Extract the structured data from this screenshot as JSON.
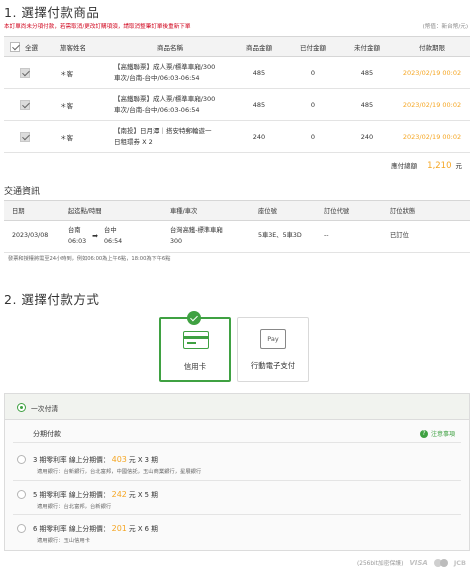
{
  "section1": {
    "title": "1. 選擇付款商品",
    "warning": "本訂單尚未分項付款，若需取消/更改訂購項須，請取消整筆訂單後重新下單",
    "unit_note": "(幣值：新台幣/元)",
    "headers": {
      "select_all": "全選",
      "traveler": "旅客姓名",
      "product": "商品名稱",
      "amount": "商品金額",
      "paid": "已付金額",
      "unpaid": "未付金額",
      "deadline": "付款期限"
    },
    "rows": [
      {
        "traveler": "＊客",
        "product_line1": "【高鐵聯票】成人票/標準車廂/300",
        "product_line2": "車次/台南-台中/06:03-06:54",
        "amount": "485",
        "paid": "0",
        "unpaid": "485",
        "deadline": "2023/02/19 00:02"
      },
      {
        "traveler": "＊客",
        "product_line1": "【高鐵聯票】成人票/標準車廂/300",
        "product_line2": "車次/台南-台中/06:03-06:54",
        "amount": "485",
        "paid": "0",
        "unpaid": "485",
        "deadline": "2023/02/19 00:02"
      },
      {
        "traveler": "＊客",
        "product_line1": "【南投】日月潭｜搭安特郵輪遊一",
        "product_line2": "日租環券 X 2",
        "amount": "240",
        "paid": "0",
        "unpaid": "240",
        "deadline": "2023/02/19 00:02"
      }
    ],
    "total_label": "應付總額",
    "total_amount": "1,210",
    "total_unit": "元"
  },
  "transport": {
    "title": "交通資訊",
    "headers": {
      "date": "日期",
      "route": "起迄點/時間",
      "train": "車種/車次",
      "seat": "座位號",
      "seat_code": "訂位代號",
      "status": "訂位狀態"
    },
    "row": {
      "date": "2023/03/08",
      "from_station": "台南",
      "from_time": "06:03",
      "arrow": "➡",
      "to_station": "台中",
      "to_time": "06:54",
      "train_line1": "台灣高鐵-標準車廂",
      "train_line2": "300",
      "seat": "5車3E、5車3D",
      "seat_code": "--",
      "status": "已訂位"
    },
    "note": "發票和授權將需至24小時到，例如06:00為上午6點，18:00為下午6點"
  },
  "section2": {
    "title": "2. 選擇付款方式",
    "methods": [
      {
        "label": "信用卡",
        "icon": "credit-card-icon",
        "selected": true
      },
      {
        "label": "行動電子支付",
        "icon": "pay-icon",
        "icon_text": "Pay",
        "selected": false
      }
    ]
  },
  "plans": {
    "lump_sum_label": "一次付清",
    "installment_title": "分期付款",
    "notice_label": "注意事項",
    "notice_icon": "?",
    "options": [
      {
        "line1_prefix": "3 期零利率  線上分期價：",
        "price": "403",
        "line1_suffix": "元 X 3 期",
        "banks": "適用銀行：台新銀行，台北富邦，中國信託，玉山商業銀行，星展銀行"
      },
      {
        "line1_prefix": "5 期零利率  線上分期價：",
        "price": "242",
        "line1_suffix": "元 X 5 期",
        "banks": "適用銀行：台北富邦，台新銀行"
      },
      {
        "line1_prefix": "6 期零利率  線上分期價：",
        "price": "201",
        "line1_suffix": "元 X 6 期",
        "banks": "適用銀行：玉山信用卡"
      }
    ]
  },
  "footer": {
    "ssl": "(256bit加密保護)",
    "visa": "VISA",
    "jcb": "JCB"
  },
  "colors": {
    "accent_green": "#3fa142",
    "price_orange": "#f5a623",
    "warning_red": "#d0021b"
  }
}
